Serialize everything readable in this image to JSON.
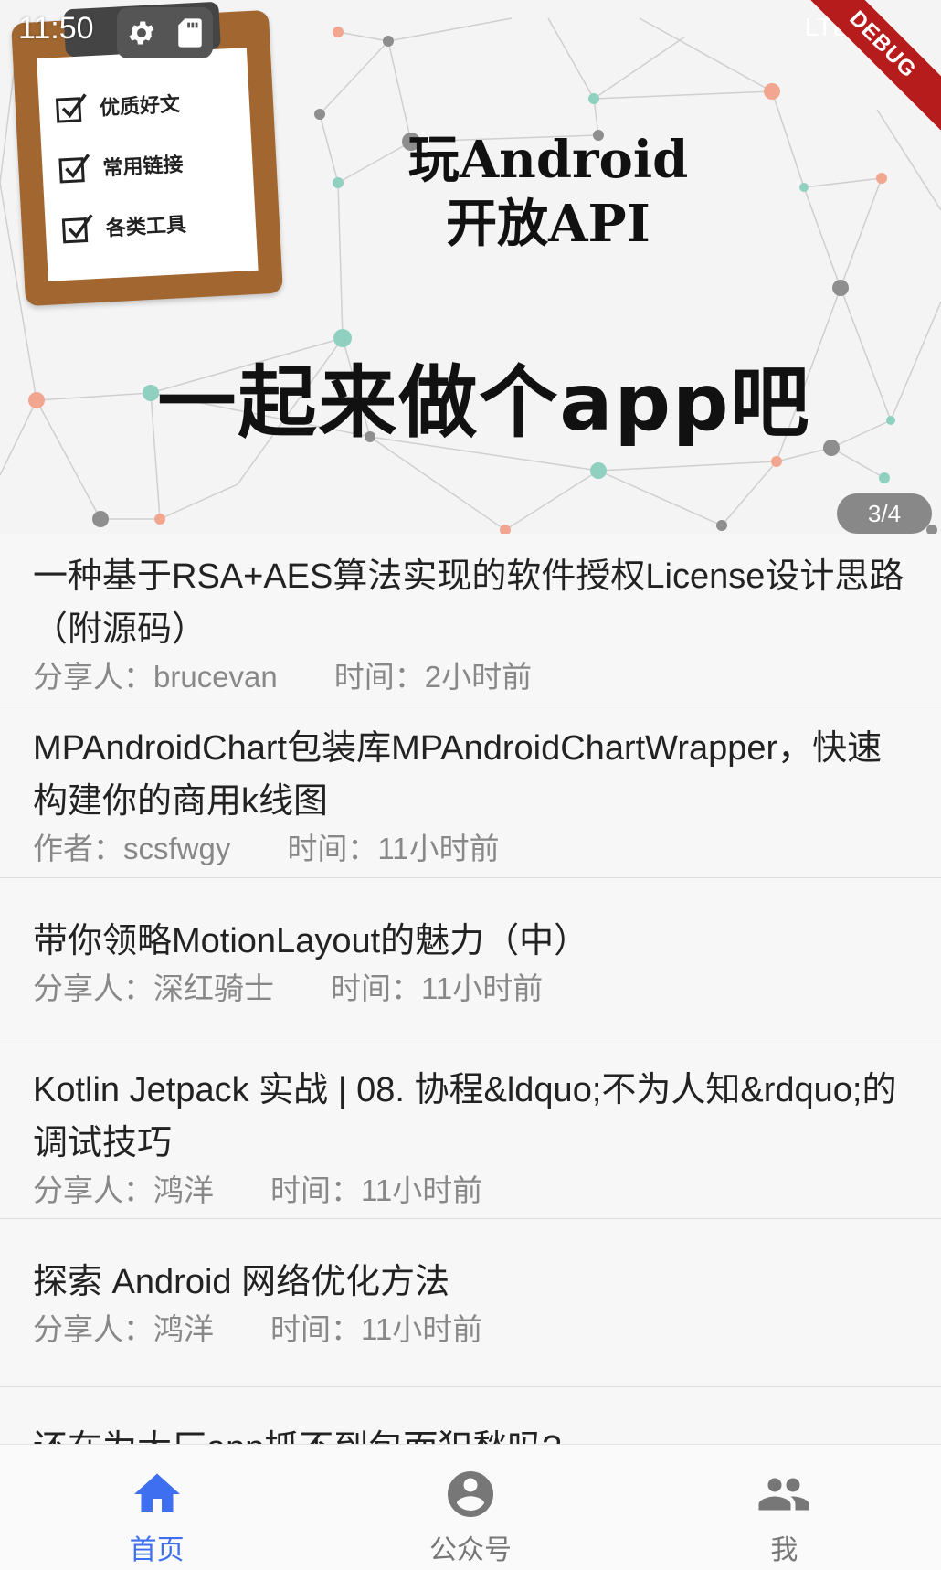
{
  "colors": {
    "accent": "#3d6ff0",
    "inactive": "#777777",
    "meta_text": "#888888",
    "ribbon": "#b71c1c"
  },
  "status_bar": {
    "time": "11:50",
    "network": "LTE"
  },
  "debug_label": "DEBUG",
  "banner": {
    "clipboard_items": [
      "优质好文",
      "常用链接",
      "各类工具"
    ],
    "title_line1": "玩Android",
    "title_line2": "开放API",
    "slogan": "一起来做个app吧",
    "pager": "3/4"
  },
  "articles": [
    {
      "title": "一种基于RSA+AES算法实现的软件授权License设计思路（附源码）",
      "author": "分享人：brucevan",
      "time": "时间：2小时前"
    },
    {
      "title": "MPAndroidChart包装库MPAndroidChartWrapper，快速构建你的商用k线图",
      "author": "作者：scsfwgy",
      "time": "时间：11小时前"
    },
    {
      "title": "带你领略MotionLayout的魅力（中）",
      "author": "分享人：深红骑士",
      "time": "时间：11小时前"
    },
    {
      "title": "Kotlin Jetpack 实战 | 08. 协程&ldquo;不为人知&rdquo;的调试技巧",
      "author": "分享人：鸿洋",
      "time": "时间：11小时前"
    },
    {
      "title": "探索 Android 网络优化方法",
      "author": "分享人：鸿洋",
      "time": "时间：11小时前"
    },
    {
      "title": "还在为大厂app抓不到包而犯愁吗?",
      "author": "",
      "time": ""
    }
  ],
  "bottom_nav": [
    {
      "label": "首页",
      "icon": "home-icon",
      "active": true
    },
    {
      "label": "公众号",
      "icon": "account-circle-icon",
      "active": false
    },
    {
      "label": "我",
      "icon": "people-icon",
      "active": false
    }
  ]
}
